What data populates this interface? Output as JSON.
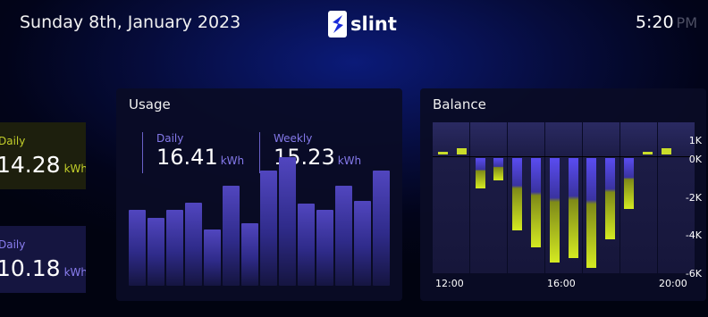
{
  "header": {
    "date": "Sunday 8th, January 2023",
    "logo_text": "slint",
    "time": "5:20",
    "ampm": "PM"
  },
  "tiles": [
    {
      "label": "Daily",
      "value": "14.28",
      "unit": "kWh",
      "color": "#c3cf2a"
    },
    {
      "label": "Daily",
      "value": "10.18",
      "unit": "kWh",
      "color": "#8a7ef0"
    }
  ],
  "usage": {
    "title": "Usage",
    "stats": [
      {
        "label": "Daily",
        "value": "16.41",
        "unit": "kWh"
      },
      {
        "label": "Weekly",
        "value": "15.23",
        "unit": "kWh"
      }
    ],
    "bars": [
      5.0,
      4.5,
      5.0,
      5.5,
      3.7,
      6.6,
      4.1,
      7.6,
      8.5,
      5.4,
      5.0,
      6.6,
      5.6,
      7.6
    ]
  },
  "balance": {
    "title": "Balance",
    "y_ticks": [
      "1K",
      "0K",
      "-2K",
      "-4K",
      "-6K"
    ],
    "x_ticks": [
      "12:00",
      "16:00",
      "20:00"
    ],
    "bars": [
      0.15,
      0.35,
      -1.6,
      -1.2,
      -3.8,
      -4.7,
      -5.5,
      -5.3,
      -5.8,
      -4.3,
      -2.7,
      0.15,
      0.35
    ],
    "accent_positive": "#c9dc2a",
    "accent_negative": "#5a4cf0"
  }
}
